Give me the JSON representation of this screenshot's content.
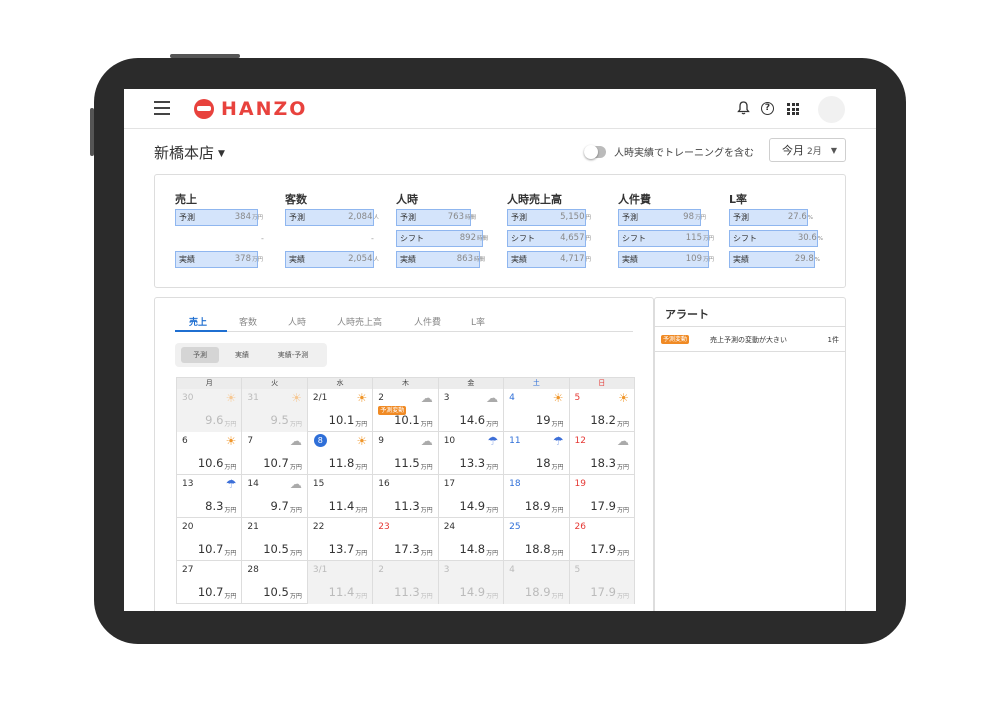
{
  "app": {
    "logo": "HANZO"
  },
  "header": {
    "store": "新橋本店",
    "training_toggle_label": "人時実績でトレーニングを含む",
    "month_select": {
      "label": "今月",
      "sub": "2月"
    }
  },
  "summary": [
    {
      "title": "売上",
      "rows": [
        {
          "type": "bar",
          "label": "予測",
          "value": "384",
          "unit": "万円",
          "fill": 0.77
        },
        {
          "type": "dash"
        },
        {
          "type": "bar",
          "label": "実績",
          "value": "378",
          "unit": "万円",
          "fill": 0.77
        }
      ]
    },
    {
      "title": "客数",
      "rows": [
        {
          "type": "bar",
          "label": "予測",
          "value": "2,084",
          "unit": "人",
          "fill": 0.82
        },
        {
          "type": "dash"
        },
        {
          "type": "bar",
          "label": "実績",
          "value": "2,054",
          "unit": "人",
          "fill": 0.82
        }
      ]
    },
    {
      "title": "人時",
      "rows": [
        {
          "type": "bar",
          "label": "予測",
          "value": "763",
          "unit": "時間",
          "fill": 0.69
        },
        {
          "type": "bar",
          "label": "シフト",
          "value": "892",
          "unit": "時間",
          "fill": 0.81
        },
        {
          "type": "bar",
          "label": "実績",
          "value": "863",
          "unit": "時間",
          "fill": 0.78
        }
      ]
    },
    {
      "title": "人時売上高",
      "rows": [
        {
          "type": "bar",
          "label": "予測",
          "value": "5,150",
          "unit": "円",
          "fill": 0.73
        },
        {
          "type": "bar",
          "label": "シフト",
          "value": "4,657",
          "unit": "円",
          "fill": 0.73
        },
        {
          "type": "bar",
          "label": "実績",
          "value": "4,717",
          "unit": "円",
          "fill": 0.73
        }
      ]
    },
    {
      "title": "人件費",
      "rows": [
        {
          "type": "bar",
          "label": "予測",
          "value": "98",
          "unit": "万円",
          "fill": 0.77
        },
        {
          "type": "bar",
          "label": "シフト",
          "value": "115",
          "unit": "万円",
          "fill": 0.84
        },
        {
          "type": "bar",
          "label": "実績",
          "value": "109",
          "unit": "万円",
          "fill": 0.84
        }
      ]
    },
    {
      "title": "L率",
      "rows": [
        {
          "type": "bar",
          "label": "予測",
          "value": "27.6",
          "unit": "%",
          "fill": 0.73
        },
        {
          "type": "bar",
          "label": "シフト",
          "value": "30.6",
          "unit": "%",
          "fill": 0.82
        },
        {
          "type": "bar",
          "label": "実績",
          "value": "29.8",
          "unit": "%",
          "fill": 0.8
        }
      ]
    }
  ],
  "tabs": [
    "売上",
    "客数",
    "人時",
    "人時売上高",
    "人件費",
    "L率"
  ],
  "segments": [
    "予測",
    "実績",
    "実績-予測"
  ],
  "calendar": {
    "weekdays": [
      "月",
      "火",
      "水",
      "木",
      "金",
      "土",
      "日"
    ],
    "unit": "万円",
    "badge_label": "予測変動",
    "weeks": [
      [
        {
          "day": "30",
          "value": "9.6",
          "weather": "sunny",
          "out": true
        },
        {
          "day": "31",
          "value": "9.5",
          "weather": "sunny",
          "out": true
        },
        {
          "day": "2/1",
          "value": "10.1",
          "weather": "sunny"
        },
        {
          "day": "2",
          "value": "10.1",
          "weather": "cloudy",
          "badge": true
        },
        {
          "day": "3",
          "value": "14.6",
          "weather": "cloudy"
        },
        {
          "day": "4",
          "value": "19",
          "weather": "sunny"
        },
        {
          "day": "5",
          "value": "18.2",
          "weather": "sunny"
        }
      ],
      [
        {
          "day": "6",
          "value": "10.6",
          "weather": "sunny"
        },
        {
          "day": "7",
          "value": "10.7",
          "weather": "cloudy"
        },
        {
          "day": "8",
          "value": "11.8",
          "weather": "sunny",
          "today": true
        },
        {
          "day": "9",
          "value": "11.5",
          "weather": "cloudy"
        },
        {
          "day": "10",
          "value": "13.3",
          "weather": "rain"
        },
        {
          "day": "11",
          "value": "18",
          "weather": "rain"
        },
        {
          "day": "12",
          "value": "18.3",
          "weather": "cloudy"
        }
      ],
      [
        {
          "day": "13",
          "value": "8.3",
          "weather": "rain"
        },
        {
          "day": "14",
          "value": "9.7",
          "weather": "cloudy"
        },
        {
          "day": "15",
          "value": "11.4"
        },
        {
          "day": "16",
          "value": "11.3"
        },
        {
          "day": "17",
          "value": "14.9"
        },
        {
          "day": "18",
          "value": "18.9"
        },
        {
          "day": "19",
          "value": "17.9"
        }
      ],
      [
        {
          "day": "20",
          "value": "10.7"
        },
        {
          "day": "21",
          "value": "10.5"
        },
        {
          "day": "22",
          "value": "13.7"
        },
        {
          "day": "23",
          "value": "17.3",
          "holiday": true
        },
        {
          "day": "24",
          "value": "14.8"
        },
        {
          "day": "25",
          "value": "18.8"
        },
        {
          "day": "26",
          "value": "17.9"
        }
      ],
      [
        {
          "day": "27",
          "value": "10.7"
        },
        {
          "day": "28",
          "value": "10.5"
        },
        {
          "day": "3/1",
          "value": "11.4",
          "out": true
        },
        {
          "day": "2",
          "value": "11.3",
          "out": true
        },
        {
          "day": "3",
          "value": "14.9",
          "out": true
        },
        {
          "day": "4",
          "value": "18.9",
          "out": true
        },
        {
          "day": "5",
          "value": "17.9",
          "out": true
        }
      ]
    ]
  },
  "alerts": {
    "title": "アラート",
    "items": [
      {
        "badge": "予測変動",
        "text": "売上予測の変動が大きい",
        "count": "1件"
      }
    ]
  },
  "colors": {
    "brand": "#e8423d",
    "accent": "#1f6fd1",
    "bar_fill": "#d4e4fb",
    "bar_border": "#8fb6ef",
    "badge": "#f08a24",
    "saturday": "#2f6fd8",
    "sunday": "#e53935"
  }
}
